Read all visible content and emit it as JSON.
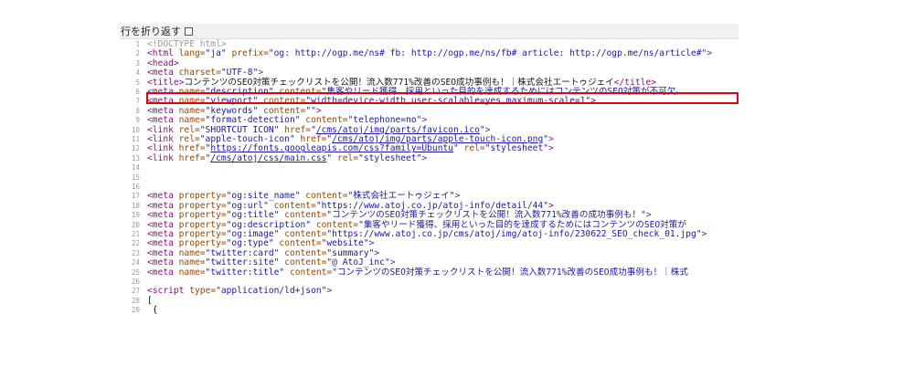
{
  "toolbar": {
    "wrap_label": "行を折り返す"
  },
  "lines": [
    {
      "n": "1",
      "parts": [
        [
          "comment",
          "<!DOCTYPE html>"
        ]
      ]
    },
    {
      "n": "2",
      "parts": [
        [
          "tag",
          "<html "
        ],
        [
          "attr",
          "lang="
        ],
        [
          "val",
          "\"ja\" "
        ],
        [
          "attr",
          "prefix="
        ],
        [
          "val",
          "\"og: http://ogp.me/ns# fb: http://ogp.me/ns/fb# article: http://ogp.me/ns/article#\""
        ],
        [
          "tag",
          ">"
        ]
      ]
    },
    {
      "n": "3",
      "parts": [
        [
          "tag",
          "<head>"
        ]
      ]
    },
    {
      "n": "4",
      "parts": [
        [
          "tag",
          "<meta "
        ],
        [
          "attr",
          "charset="
        ],
        [
          "val",
          "\"UTF-8\""
        ],
        [
          "tag",
          ">"
        ]
      ]
    },
    {
      "n": "5",
      "parts": [
        [
          "tag",
          "<title>"
        ],
        [
          "text",
          "コンテンツのSEO対策チェックリストを公開！流入数771%改善のSEO成功事例も！｜株式会社エートゥジェイ"
        ],
        [
          "tag",
          "</title>"
        ]
      ]
    },
    {
      "n": "6",
      "parts": [
        [
          "tag",
          "<meta "
        ],
        [
          "attr",
          "name="
        ],
        [
          "val",
          "\"description\" "
        ],
        [
          "attr",
          "content="
        ],
        [
          "val",
          "\"集客やリード獲得、採用といった目的を達成するためにはコンテンツのSEO対策が不可欠。"
        ]
      ]
    },
    {
      "n": "7",
      "parts": [
        [
          "tag",
          "<meta "
        ],
        [
          "attr",
          "name="
        ],
        [
          "val",
          "\"viewport\" "
        ],
        [
          "attr",
          "content="
        ],
        [
          "val",
          "\"width=device-width,user-scalable=yes,maximum-scale=1\""
        ],
        [
          "tag",
          ">"
        ]
      ]
    },
    {
      "n": "8",
      "parts": [
        [
          "tag",
          "<meta "
        ],
        [
          "attr",
          "name="
        ],
        [
          "val",
          "\"keywords\" "
        ],
        [
          "attr",
          "content="
        ],
        [
          "val",
          "\"\""
        ],
        [
          "tag",
          ">"
        ]
      ]
    },
    {
      "n": "9",
      "parts": [
        [
          "tag",
          "<meta "
        ],
        [
          "attr",
          "name="
        ],
        [
          "val",
          "\"format-detection\" "
        ],
        [
          "attr",
          "content="
        ],
        [
          "val",
          "\"telephone=no\""
        ],
        [
          "tag",
          ">"
        ]
      ]
    },
    {
      "n": "10",
      "parts": [
        [
          "tag",
          "<link "
        ],
        [
          "attr",
          "rel="
        ],
        [
          "val",
          "\"SHORTCUT ICON\" "
        ],
        [
          "attr",
          "href="
        ],
        [
          "val",
          "\""
        ],
        [
          "link",
          "/cms/atoj/img/parts/favicon.ico"
        ],
        [
          "val",
          "\""
        ],
        [
          "tag",
          ">"
        ]
      ]
    },
    {
      "n": "11",
      "parts": [
        [
          "tag",
          "<link "
        ],
        [
          "attr",
          "rel="
        ],
        [
          "val",
          "\"apple-touch-icon\" "
        ],
        [
          "attr",
          "href="
        ],
        [
          "val",
          "\""
        ],
        [
          "link",
          "/cms/atoj/img/parts/apple-touch-icon.png"
        ],
        [
          "val",
          "\""
        ],
        [
          "tag",
          ">"
        ]
      ]
    },
    {
      "n": "12",
      "parts": [
        [
          "tag",
          "<link "
        ],
        [
          "attr",
          "href="
        ],
        [
          "val",
          "\""
        ],
        [
          "link",
          "https://fonts.googleapis.com/css?family=Ubuntu"
        ],
        [
          "val",
          "\" "
        ],
        [
          "attr",
          "rel="
        ],
        [
          "val",
          "\"stylesheet\""
        ],
        [
          "tag",
          ">"
        ]
      ]
    },
    {
      "n": "13",
      "parts": [
        [
          "tag",
          "<link "
        ],
        [
          "attr",
          "href="
        ],
        [
          "val",
          "\""
        ],
        [
          "link",
          "/cms/atoj/css/main.css"
        ],
        [
          "val",
          "\"  "
        ],
        [
          "attr",
          "rel="
        ],
        [
          "val",
          "\"stylesheet\""
        ],
        [
          "tag",
          ">"
        ]
      ]
    },
    {
      "n": "14",
      "parts": []
    },
    {
      "n": "15",
      "parts": []
    },
    {
      "n": "16",
      "parts": []
    },
    {
      "n": "17",
      "parts": [
        [
          "tag",
          "<meta "
        ],
        [
          "attr",
          "property="
        ],
        [
          "val",
          "\"og:site_name\" "
        ],
        [
          "attr",
          "content="
        ],
        [
          "val",
          "\"株式会社エートゥジェイ\""
        ],
        [
          "tag",
          ">"
        ]
      ]
    },
    {
      "n": "18",
      "parts": [
        [
          "tag",
          "<meta "
        ],
        [
          "attr",
          "property="
        ],
        [
          "val",
          "\"og:url\" "
        ],
        [
          "attr",
          "content="
        ],
        [
          "val",
          "\"https://www.atoj.co.jp/atoj-info/detail/44\""
        ],
        [
          "tag",
          ">"
        ]
      ]
    },
    {
      "n": "19",
      "parts": [
        [
          "tag",
          "<meta "
        ],
        [
          "attr",
          "property="
        ],
        [
          "val",
          "\"og:title\" "
        ],
        [
          "attr",
          "content="
        ],
        [
          "val",
          "\"コンテンツのSEO対策チェックリストを公開！流入数771%改善の成功事例も！\""
        ],
        [
          "tag",
          ">"
        ]
      ]
    },
    {
      "n": "20",
      "parts": [
        [
          "tag",
          "<meta "
        ],
        [
          "attr",
          "property="
        ],
        [
          "val",
          "\"og:description\" "
        ],
        [
          "attr",
          "content="
        ],
        [
          "val",
          "\"集客やリード獲得、採用といった目的を達成するためにはコンテンツのSEO対策が"
        ]
      ]
    },
    {
      "n": "21",
      "parts": [
        [
          "tag",
          "<meta "
        ],
        [
          "attr",
          "property="
        ],
        [
          "val",
          "\"og:image\" "
        ],
        [
          "attr",
          "content="
        ],
        [
          "val",
          "\"https://www.atoj.co.jp/cms/atoj/img/atoj-info/230622_SEO_check_01.jpg\""
        ],
        [
          "tag",
          ">"
        ]
      ]
    },
    {
      "n": "22",
      "parts": [
        [
          "tag",
          "<meta "
        ],
        [
          "attr",
          "property="
        ],
        [
          "val",
          "\"og:type\" "
        ],
        [
          "attr",
          "content="
        ],
        [
          "val",
          "\"website\""
        ],
        [
          "tag",
          ">"
        ]
      ]
    },
    {
      "n": "23",
      "parts": [
        [
          "tag",
          "<meta "
        ],
        [
          "attr",
          "name="
        ],
        [
          "val",
          "\"twitter:card\" "
        ],
        [
          "attr",
          "content="
        ],
        [
          "val",
          "\"summary\""
        ],
        [
          "tag",
          ">"
        ]
      ]
    },
    {
      "n": "24",
      "parts": [
        [
          "tag",
          "<meta "
        ],
        [
          "attr",
          "name="
        ],
        [
          "val",
          "\"twitter:site\" "
        ],
        [
          "attr",
          "content="
        ],
        [
          "val",
          "\"@ AtoJ_inc\""
        ],
        [
          "tag",
          ">"
        ]
      ]
    },
    {
      "n": "25",
      "parts": [
        [
          "tag",
          "<meta "
        ],
        [
          "attr",
          "name="
        ],
        [
          "val",
          "\"twitter:title\" "
        ],
        [
          "attr",
          "content="
        ],
        [
          "val",
          "\"コンテンツのSEO対策チェックリストを公開！流入数771%改善のSEO成功事例も！｜株式"
        ]
      ]
    },
    {
      "n": "26",
      "parts": []
    },
    {
      "n": "27",
      "parts": [
        [
          "tag",
          "<script "
        ],
        [
          "attr",
          "type="
        ],
        [
          "val",
          "\"application/ld+json\""
        ],
        [
          "tag",
          ">"
        ]
      ]
    },
    {
      "n": "28",
      "parts": [
        [
          "text",
          "["
        ]
      ]
    },
    {
      "n": "29",
      "parts": [
        [
          "text",
          "    {"
        ]
      ]
    }
  ]
}
